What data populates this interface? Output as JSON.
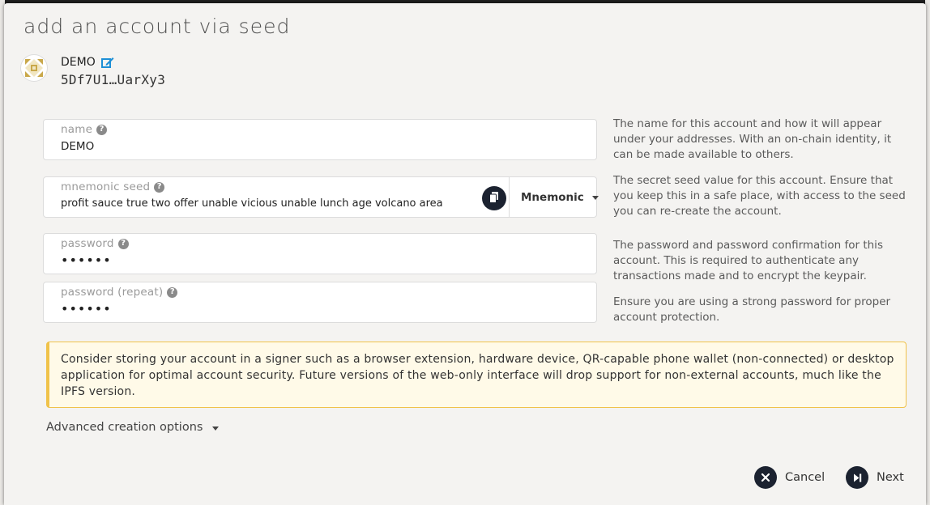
{
  "modal": {
    "title": "add an account via seed"
  },
  "account": {
    "name": "DEMO",
    "address": "5Df7U1…UarXy3"
  },
  "fields": {
    "name": {
      "label": "name",
      "value": "DEMO"
    },
    "seed": {
      "label": "mnemonic seed",
      "value": "profit sauce true two offer unable vicious unable lunch age volcano area",
      "type_selected": "Mnemonic"
    },
    "password": {
      "label": "password",
      "value": "••••••"
    },
    "password_repeat": {
      "label": "password (repeat)",
      "value": "••••••"
    }
  },
  "help": {
    "name": "The name for this account and how it will appear under your addresses. With an on-chain identity, it can be made available to others.",
    "seed": "The secret seed value for this account. Ensure that you keep this in a safe place, with access to the seed you can re-create the account.",
    "password": "The password and password confirmation for this account. This is required to authenticate any transactions made and to encrypt the keypair.",
    "password_repeat": "Ensure you are using a strong password for proper account protection."
  },
  "notice": "Consider storing your account in a signer such as a browser extension, hardware device, QR-capable phone wallet (non-connected) or desktop application for optimal account security. Future versions of the web-only interface will drop support for non-external accounts, much like the IPFS version.",
  "advanced_label": "Advanced creation options",
  "buttons": {
    "cancel": "Cancel",
    "next": "Next"
  },
  "colors": {
    "button_bg": "#1b2230",
    "notice_border": "#f0c24a",
    "notice_bg": "#fffae8",
    "edit_icon": "#1d8fd6"
  }
}
